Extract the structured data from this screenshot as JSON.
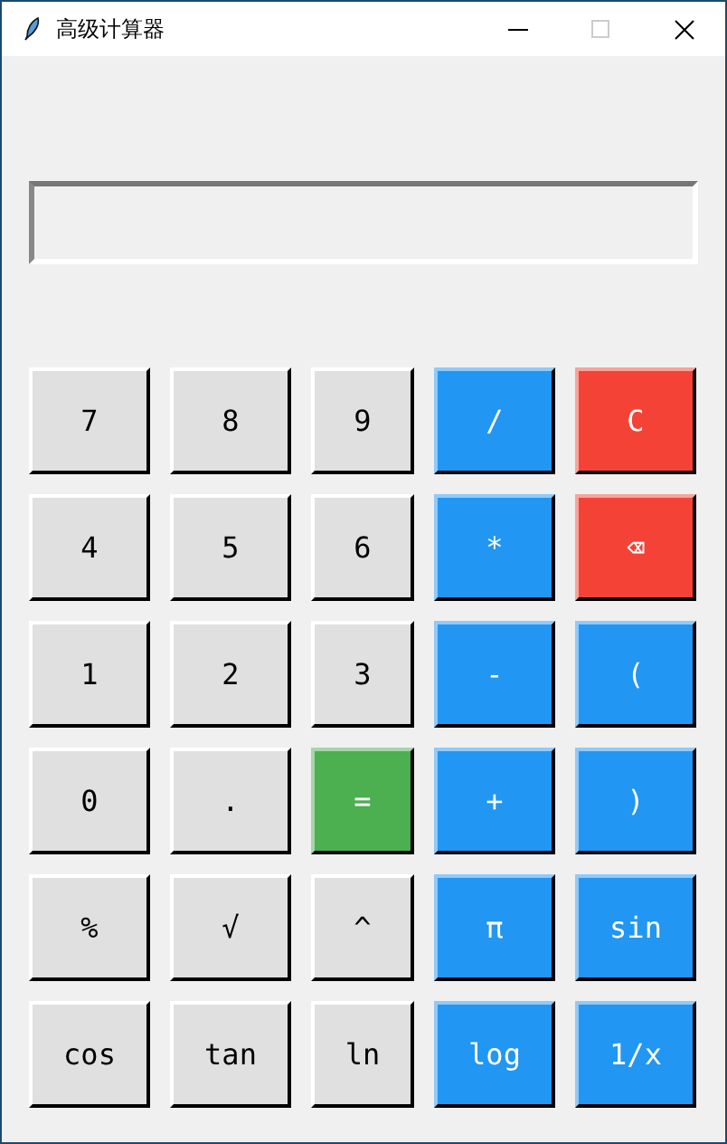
{
  "window": {
    "title": "高级计算器"
  },
  "keypad": [
    [
      {
        "label": "7",
        "kind": "digit"
      },
      {
        "label": "8",
        "kind": "digit"
      },
      {
        "label": "9",
        "kind": "digit"
      },
      {
        "label": "/",
        "kind": "operator"
      },
      {
        "label": "C",
        "kind": "clear"
      }
    ],
    [
      {
        "label": "4",
        "kind": "digit"
      },
      {
        "label": "5",
        "kind": "digit"
      },
      {
        "label": "6",
        "kind": "digit"
      },
      {
        "label": "*",
        "kind": "operator"
      },
      {
        "label": "⌫",
        "kind": "clear"
      }
    ],
    [
      {
        "label": "1",
        "kind": "digit"
      },
      {
        "label": "2",
        "kind": "digit"
      },
      {
        "label": "3",
        "kind": "digit"
      },
      {
        "label": "-",
        "kind": "operator"
      },
      {
        "label": "(",
        "kind": "operator"
      }
    ],
    [
      {
        "label": "0",
        "kind": "digit"
      },
      {
        "label": ".",
        "kind": "digit"
      },
      {
        "label": "=",
        "kind": "equals"
      },
      {
        "label": "+",
        "kind": "operator"
      },
      {
        "label": ")",
        "kind": "operator"
      }
    ],
    [
      {
        "label": "%",
        "kind": "digit"
      },
      {
        "label": "√",
        "kind": "digit"
      },
      {
        "label": "^",
        "kind": "digit"
      },
      {
        "label": "π",
        "kind": "operator"
      },
      {
        "label": "sin",
        "kind": "operator"
      }
    ],
    [
      {
        "label": "cos",
        "kind": "digit"
      },
      {
        "label": "tan",
        "kind": "digit"
      },
      {
        "label": "ln",
        "kind": "digit"
      },
      {
        "label": "log",
        "kind": "operator"
      },
      {
        "label": "1/x",
        "kind": "operator"
      }
    ]
  ]
}
